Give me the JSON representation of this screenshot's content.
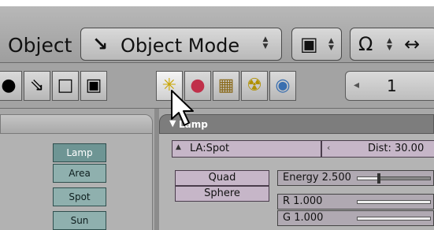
{
  "header": {
    "object_menu": "Object",
    "mode_label": "Object Mode",
    "mode_icon": "object-mode-icon"
  },
  "buttons_row": {
    "frame_value": "1",
    "prev_glyph": "◂"
  },
  "lamp_types": [
    "Lamp",
    "Area",
    "Spot",
    "Sun"
  ],
  "lamp_panel": {
    "title": "Lamp",
    "lamp_name": "LA:Spot",
    "dist": "Dist: 30.00",
    "shape_options": [
      "Quad",
      "Sphere"
    ],
    "energy_label": "Energy 2.500",
    "energy_fraction": 0.3,
    "r_label": "R 1.000",
    "g_label": "G 1.000"
  },
  "colors": {
    "type_button": "#8fb0ae",
    "lamp_field": "#c6b6c8",
    "panel_bg": "#a8a8a8"
  }
}
